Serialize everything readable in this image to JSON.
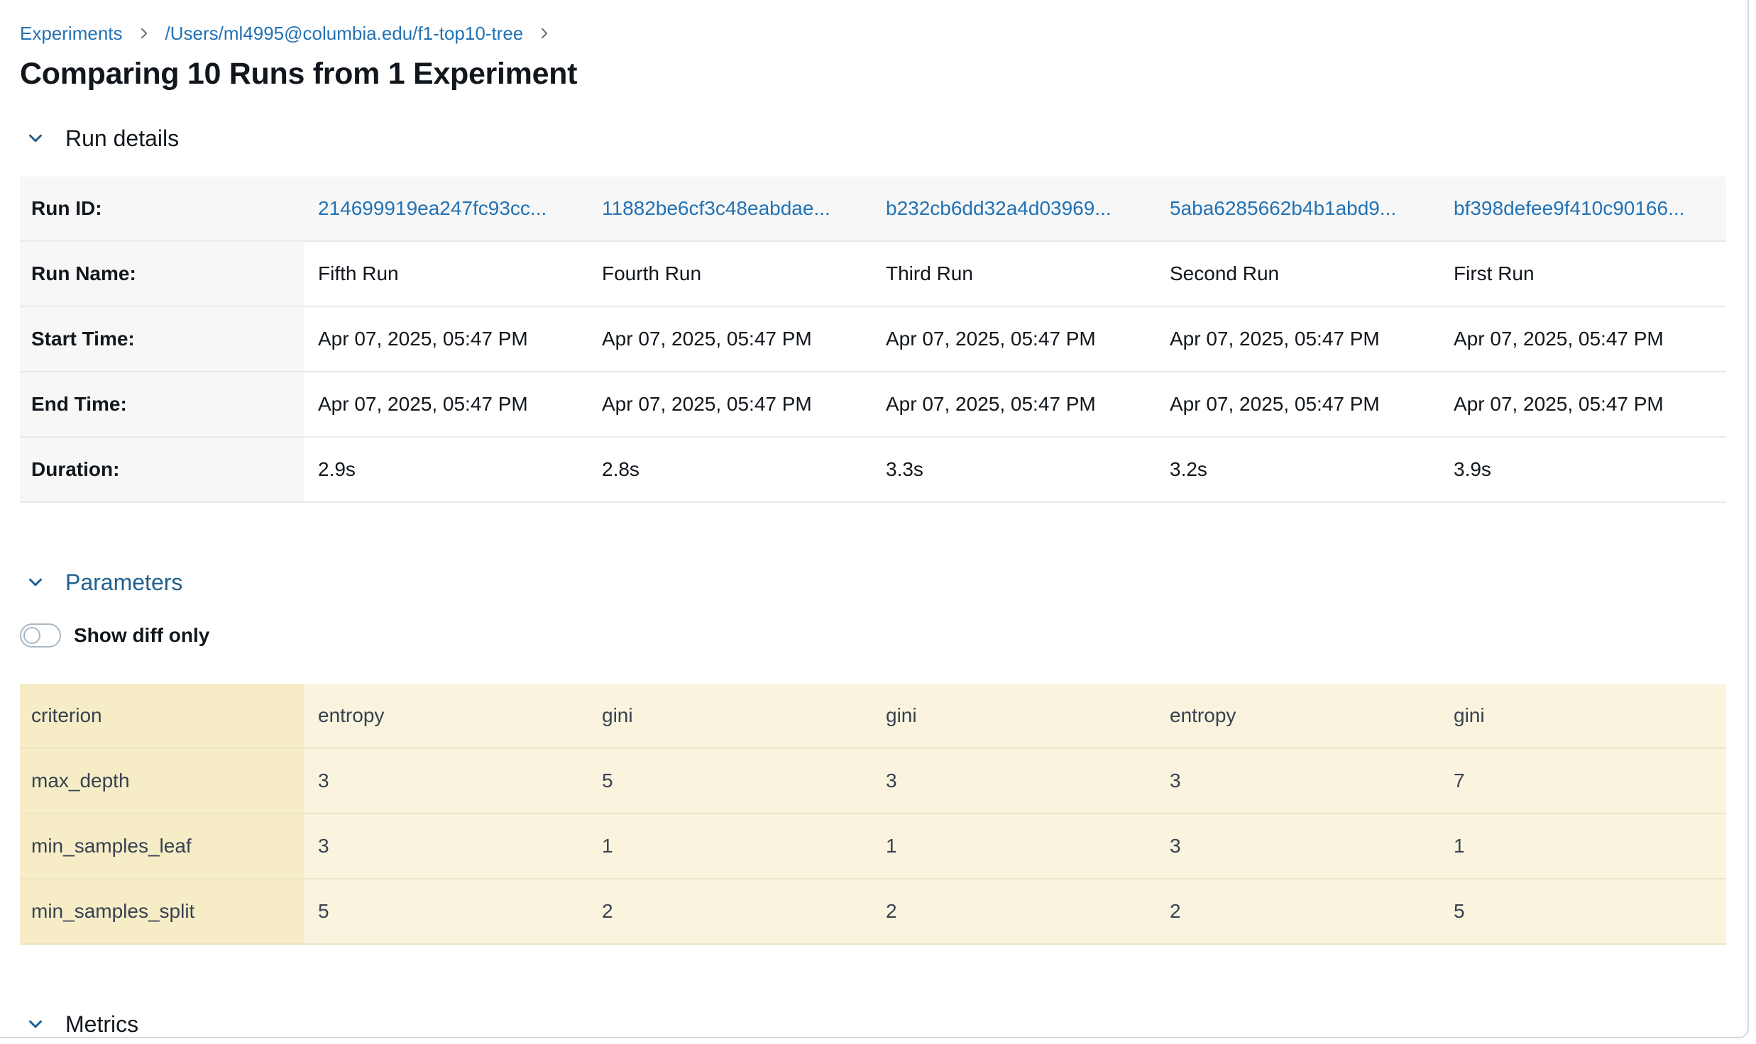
{
  "breadcrumb": {
    "items": [
      "Experiments",
      "/Users/ml4995@columbia.edu/f1-top10-tree"
    ]
  },
  "page": {
    "title": "Comparing 10 Runs from 1 Experiment"
  },
  "sections": {
    "run_details": "Run details",
    "parameters": "Parameters",
    "metrics": "Metrics"
  },
  "toggle": {
    "label": "Show diff only",
    "on": false
  },
  "run_details": {
    "row_labels": [
      "Run ID:",
      "Run Name:",
      "Start Time:",
      "End Time:",
      "Duration:"
    ],
    "runs": [
      {
        "id": "214699919ea247fc93cc...",
        "name": "Fifth Run",
        "start": "Apr 07, 2025, 05:47 PM",
        "end": "Apr 07, 2025, 05:47 PM",
        "duration": "2.9s"
      },
      {
        "id": "11882be6cf3c48eabdae...",
        "name": "Fourth Run",
        "start": "Apr 07, 2025, 05:47 PM",
        "end": "Apr 07, 2025, 05:47 PM",
        "duration": "2.8s"
      },
      {
        "id": "b232cb6dd32a4d03969...",
        "name": "Third Run",
        "start": "Apr 07, 2025, 05:47 PM",
        "end": "Apr 07, 2025, 05:47 PM",
        "duration": "3.3s"
      },
      {
        "id": "5aba6285662b4b1abd9...",
        "name": "Second Run",
        "start": "Apr 07, 2025, 05:47 PM",
        "end": "Apr 07, 2025, 05:47 PM",
        "duration": "3.2s"
      },
      {
        "id": "bf398defee9f410c90166...",
        "name": "First Run",
        "start": "Apr 07, 2025, 05:47 PM",
        "end": "Apr 07, 2025, 05:47 PM",
        "duration": "3.9s"
      }
    ]
  },
  "parameters": {
    "rows": [
      {
        "name": "criterion",
        "values": [
          "entropy",
          "gini",
          "gini",
          "entropy",
          "gini"
        ]
      },
      {
        "name": "max_depth",
        "values": [
          "3",
          "5",
          "3",
          "3",
          "7"
        ]
      },
      {
        "name": "min_samples_leaf",
        "values": [
          "3",
          "1",
          "1",
          "3",
          "1"
        ]
      },
      {
        "name": "min_samples_split",
        "values": [
          "5",
          "2",
          "2",
          "2",
          "5"
        ]
      }
    ]
  },
  "icons": {
    "breadcrumb_separator": "chevron-right-icon",
    "section_toggle": "chevron-down-icon"
  },
  "colors": {
    "link": "#2272b4",
    "param_highlight": "#faf4df"
  }
}
